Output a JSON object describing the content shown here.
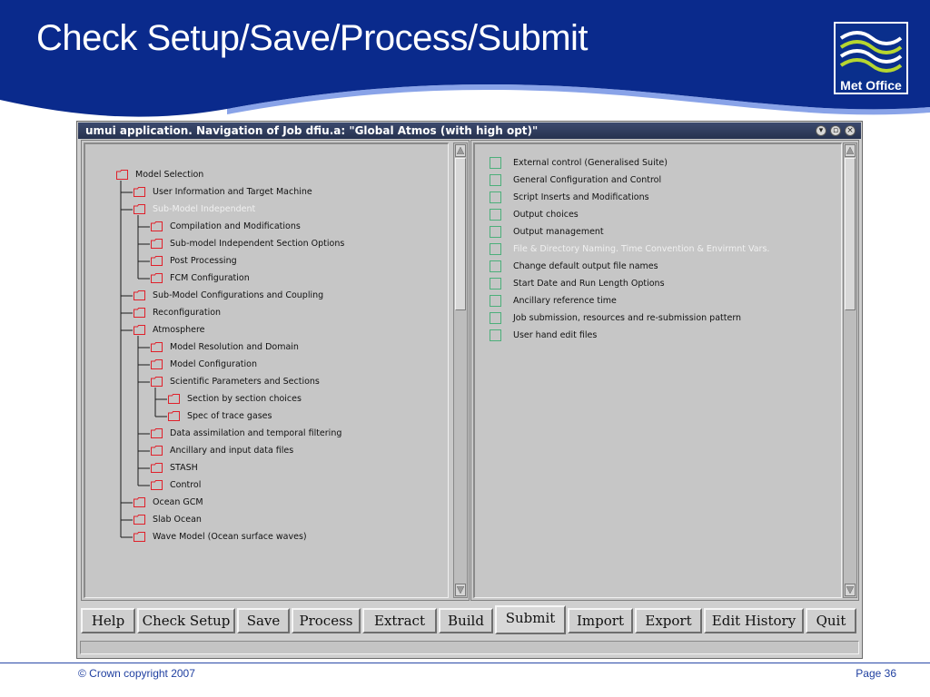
{
  "slide": {
    "title": "Check Setup/Save/Process/Submit",
    "logo_text": "Met Office",
    "copyright": "© Crown copyright 2007",
    "page": "Page 36"
  },
  "window": {
    "title": "umui application. Navigation of Job dfiu.a: \"Global Atmos (with high opt)\""
  },
  "tree": [
    {
      "label": "Model Selection",
      "depth": 0,
      "selected": false
    },
    {
      "label": "User Information and Target Machine",
      "depth": 1,
      "selected": false
    },
    {
      "label": "Sub-Model Independent",
      "depth": 1,
      "selected": true
    },
    {
      "label": "Compilation and Modifications",
      "depth": 2,
      "selected": false
    },
    {
      "label": "Sub-model Independent Section Options",
      "depth": 2,
      "selected": false
    },
    {
      "label": "Post Processing",
      "depth": 2,
      "selected": false
    },
    {
      "label": "FCM Configuration",
      "depth": 2,
      "selected": false
    },
    {
      "label": "Sub-Model Configurations and Coupling",
      "depth": 1,
      "selected": false
    },
    {
      "label": "Reconfiguration",
      "depth": 1,
      "selected": false
    },
    {
      "label": "Atmosphere",
      "depth": 1,
      "selected": false
    },
    {
      "label": "Model Resolution and Domain",
      "depth": 2,
      "selected": false
    },
    {
      "label": "Model Configuration",
      "depth": 2,
      "selected": false
    },
    {
      "label": "Scientific Parameters and Sections",
      "depth": 2,
      "selected": false
    },
    {
      "label": "Section by section choices",
      "depth": 3,
      "selected": false
    },
    {
      "label": "Spec of trace gases",
      "depth": 3,
      "selected": false
    },
    {
      "label": "Data assimilation and temporal filtering",
      "depth": 2,
      "selected": false
    },
    {
      "label": "Ancillary and input data files",
      "depth": 2,
      "selected": false
    },
    {
      "label": "STASH",
      "depth": 2,
      "selected": false
    },
    {
      "label": "Control",
      "depth": 2,
      "selected": false
    },
    {
      "label": "Ocean GCM",
      "depth": 1,
      "selected": false
    },
    {
      "label": "Slab Ocean",
      "depth": 1,
      "selected": false
    },
    {
      "label": "Wave Model (Ocean surface waves)",
      "depth": 1,
      "selected": false
    }
  ],
  "list": [
    {
      "label": "External control (Generalised Suite)",
      "selected": false
    },
    {
      "label": "General Configuration and Control",
      "selected": false
    },
    {
      "label": "Script Inserts and Modifications",
      "selected": false
    },
    {
      "label": "Output choices",
      "selected": false
    },
    {
      "label": "Output management",
      "selected": false
    },
    {
      "label": "File & Directory Naming. Time Convention & Envirmnt Vars.",
      "selected": true
    },
    {
      "label": "Change default output file names",
      "selected": false
    },
    {
      "label": "Start Date and Run Length Options",
      "selected": false
    },
    {
      "label": "Ancillary reference time",
      "selected": false
    },
    {
      "label": "Job submission, resources and re-submission pattern",
      "selected": false
    },
    {
      "label": "User hand edit files",
      "selected": false
    }
  ],
  "buttons": [
    {
      "label": "Help",
      "name": "help-button"
    },
    {
      "label": "Check Setup",
      "name": "check-setup-button"
    },
    {
      "label": "Save",
      "name": "save-button"
    },
    {
      "label": "Process",
      "name": "process-button"
    },
    {
      "label": "Extract",
      "name": "extract-button"
    },
    {
      "label": "Build",
      "name": "build-button"
    },
    {
      "label": "Submit",
      "name": "submit-button"
    },
    {
      "label": "Import",
      "name": "import-button"
    },
    {
      "label": "Export",
      "name": "export-button"
    },
    {
      "label": "Edit History",
      "name": "edit-history-button"
    },
    {
      "label": "Quit",
      "name": "quit-button"
    }
  ],
  "active_button": "Submit",
  "colors": {
    "header_blue": "#0a2a8c",
    "folder_red": "#e0202a",
    "checkbox_green": "#4caf7a"
  }
}
